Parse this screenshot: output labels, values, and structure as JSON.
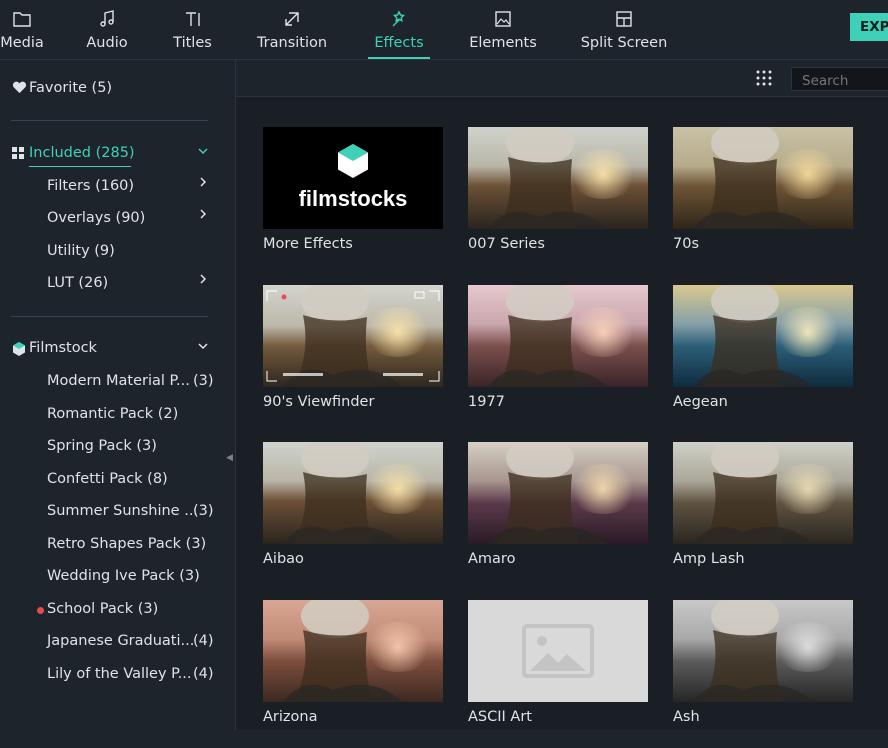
{
  "tabs": [
    {
      "label": "Media",
      "icon": "folder-icon"
    },
    {
      "label": "Audio",
      "icon": "music-note-icon"
    },
    {
      "label": "Titles",
      "icon": "text-icon"
    },
    {
      "label": "Transition",
      "icon": "transition-icon"
    },
    {
      "label": "Effects",
      "icon": "effects-icon",
      "active": true
    },
    {
      "label": "Elements",
      "icon": "image-icon"
    },
    {
      "label": "Split Screen",
      "icon": "split-screen-icon"
    }
  ],
  "export_label": "EXP",
  "accent_color": "#3fd0b8",
  "sidebar": {
    "favorite": "Favorite (5)",
    "included": {
      "label": "Included (285)",
      "items": [
        {
          "label": "Filters (160)",
          "has_chevron": true
        },
        {
          "label": "Overlays (90)",
          "has_chevron": true
        },
        {
          "label": "Utility (9)",
          "has_chevron": false
        },
        {
          "label": "LUT (26)",
          "has_chevron": true
        }
      ]
    },
    "filmstock": {
      "label": "Filmstock",
      "items": [
        {
          "label": "Modern Material P...",
          "count": "(3)"
        },
        {
          "label": "Romantic Pack (2)",
          "count": ""
        },
        {
          "label": "Spring Pack (3)",
          "count": ""
        },
        {
          "label": "Confetti Pack (8)",
          "count": ""
        },
        {
          "label": "Summer Sunshine ...",
          "count": "(3)"
        },
        {
          "label": "Retro Shapes Pack (3)",
          "count": ""
        },
        {
          "label": "Wedding Ive Pack (3)",
          "count": ""
        },
        {
          "label": "School Pack (3)",
          "count": "",
          "new": true
        },
        {
          "label": "Japanese Graduati...",
          "count": "(4)"
        },
        {
          "label": "Lily of the Valley P...",
          "count": "(4)"
        }
      ]
    }
  },
  "search": {
    "placeholder": "Search"
  },
  "effects": [
    {
      "label": "More Effects",
      "style": "filmstocks",
      "logo_text": "filmstocks"
    },
    {
      "label": "007 Series",
      "style": "warm"
    },
    {
      "label": "70s",
      "style": "seventies"
    },
    {
      "label": "90's Viewfinder",
      "style": "viewfinder"
    },
    {
      "label": "1977",
      "style": "pink"
    },
    {
      "label": "Aegean",
      "style": "aegean"
    },
    {
      "label": "Aibao",
      "style": "warm"
    },
    {
      "label": "Amaro",
      "style": "purple"
    },
    {
      "label": "Amp Lash",
      "style": "muted"
    },
    {
      "label": "Arizona",
      "style": "arizona"
    },
    {
      "label": "ASCII Art",
      "style": "placeholder"
    },
    {
      "label": "Ash",
      "style": "grey"
    }
  ]
}
